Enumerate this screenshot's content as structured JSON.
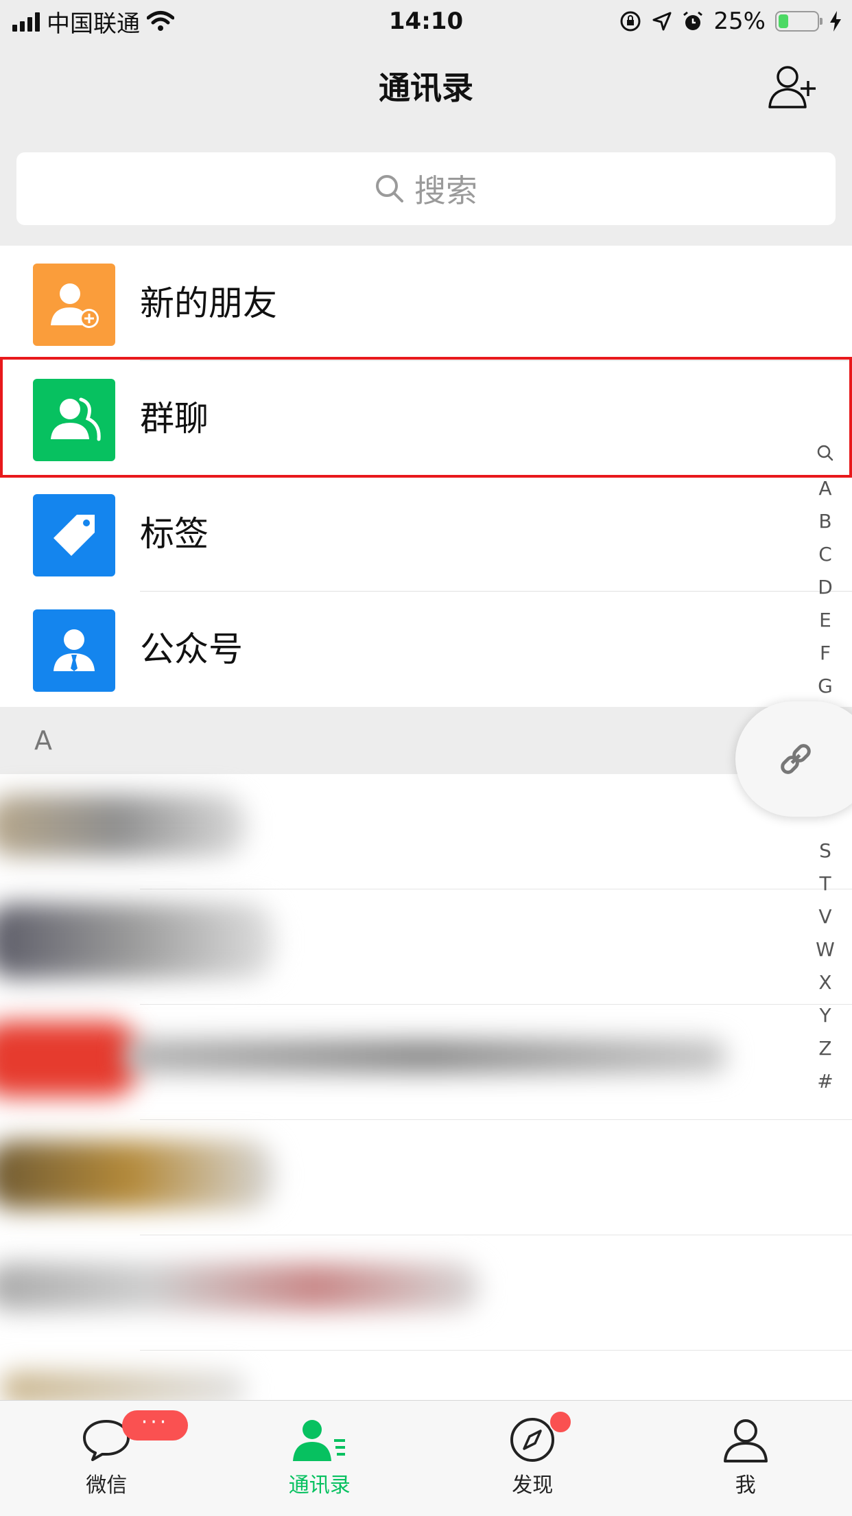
{
  "status_bar": {
    "carrier": "中国联通",
    "time": "14:10",
    "battery": "25%",
    "battery_level": 0.25,
    "icons": [
      "signal-icon",
      "wifi-icon",
      "rotation-lock-icon",
      "location-icon",
      "alarm-icon",
      "battery-icon",
      "charging-icon"
    ]
  },
  "navbar": {
    "title": "通讯录",
    "add_contact_icon": "add-contact-icon"
  },
  "search": {
    "placeholder": "搜索",
    "icon": "search-icon"
  },
  "menu": [
    {
      "label": "新的朋友",
      "icon": "new-friends-icon",
      "color": "#fa9d3b"
    },
    {
      "label": "群聊",
      "icon": "group-chat-icon",
      "color": "#07c160"
    },
    {
      "label": "标签",
      "icon": "tag-icon",
      "color": "#1485ee"
    },
    {
      "label": "公众号",
      "icon": "official-account-icon",
      "color": "#1485ee"
    }
  ],
  "highlighted_item": "群聊",
  "section": {
    "header": "A"
  },
  "index": [
    "A",
    "B",
    "C",
    "D",
    "E",
    "F",
    "G",
    "S",
    "T",
    "V",
    "W",
    "X",
    "Y",
    "Z",
    "#"
  ],
  "tabs": [
    {
      "label": "微信",
      "icon": "chat-icon",
      "badge": "···"
    },
    {
      "label": "通讯录",
      "icon": "contacts-icon",
      "active": true
    },
    {
      "label": "发现",
      "icon": "discover-icon",
      "dot": true
    },
    {
      "label": "我",
      "icon": "me-icon"
    }
  ],
  "colors": {
    "accent": "#07c160",
    "badge": "#fa5151",
    "highlight": "#e8191c"
  }
}
